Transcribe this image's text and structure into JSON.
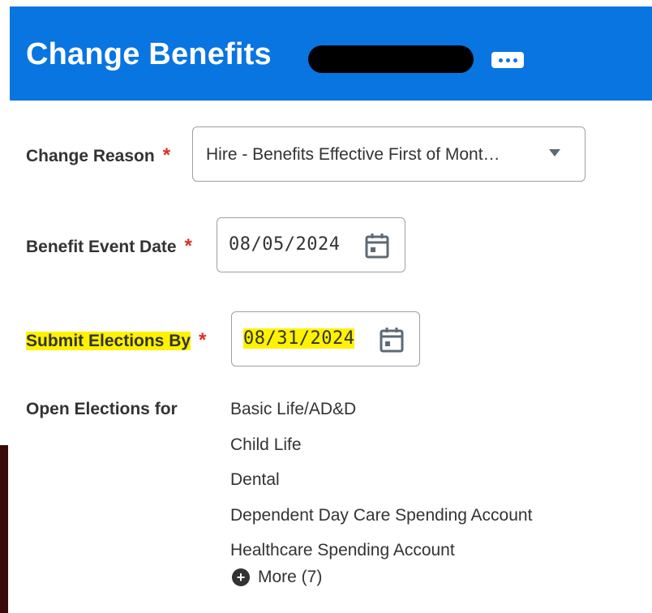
{
  "header": {
    "title": "Change Benefits"
  },
  "form": {
    "change_reason": {
      "label": "Change Reason",
      "required_mark": "*",
      "value": "Hire - Benefits Effective First of Mont…"
    },
    "benefit_event_date": {
      "label": "Benefit Event Date",
      "required_mark": "*",
      "value": "08/05/2024"
    },
    "submit_elections_by": {
      "label": "Submit Elections By",
      "required_mark": "*",
      "value": "08/31/2024"
    },
    "open_elections": {
      "label": "Open Elections for",
      "items": [
        "Basic Life/AD&D",
        "Child Life",
        "Dental",
        "Dependent Day Care Spending Account",
        "Healthcare Spending Account"
      ],
      "more_label": "More (7)"
    }
  },
  "colors": {
    "header_bg": "#0875e1",
    "required": "#de2e21",
    "highlight": "#fff200"
  },
  "icons": {
    "more": "ellipsis-icon",
    "calendar": "calendar-icon",
    "select": "caret-down-icon",
    "expand": "plus-circle-icon"
  }
}
